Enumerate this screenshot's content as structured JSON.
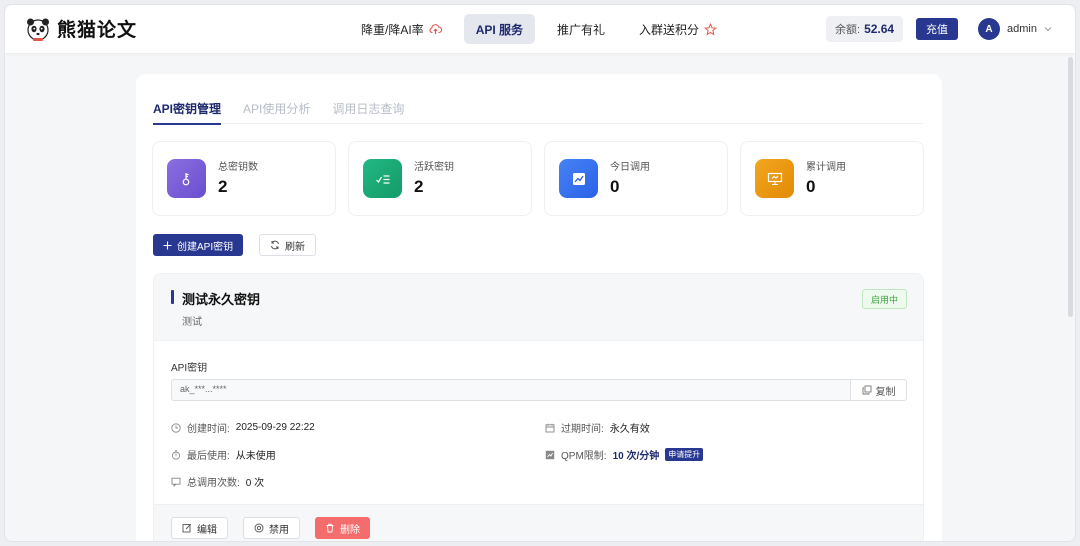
{
  "brand": {
    "name": "熊猫论文"
  },
  "nav": {
    "items": [
      {
        "label": "降重/降AI率",
        "icon": "cloud-upload-icon"
      },
      {
        "label": "API 服务",
        "active": true
      },
      {
        "label": "推广有礼"
      },
      {
        "label": "入群送积分",
        "icon": "star-icon"
      }
    ]
  },
  "header": {
    "balance_label": "余额:",
    "balance_value": "52.64",
    "recharge_label": "充值",
    "user_initial": "A",
    "username": "admin"
  },
  "tabs": [
    "API密钥管理",
    "API使用分析",
    "调用日志查询"
  ],
  "stats": [
    {
      "label": "总密钥数",
      "value": "2",
      "icon": "key-icon",
      "color": "#7a5cd6"
    },
    {
      "label": "活跃密钥",
      "value": "2",
      "icon": "check-list-icon",
      "color": "#19a874"
    },
    {
      "label": "今日调用",
      "value": "0",
      "icon": "trend-chart-icon",
      "color": "#2f6cf0"
    },
    {
      "label": "累计调用",
      "value": "0",
      "icon": "presentation-icon",
      "color": "#ee9a0e"
    }
  ],
  "actions": {
    "create_label": "创建API密钥",
    "refresh_label": "刷新"
  },
  "key_card": {
    "name": "测试永久密钥",
    "description": "测试",
    "status": "启用中",
    "key_label": "API密钥",
    "key_value": "ak_***...****",
    "copy_label": "复制",
    "created_label": "创建时间:",
    "created_value": "2025-09-29 22:22",
    "expire_label": "过期时间:",
    "expire_value": "永久有效",
    "last_used_label": "最后使用:",
    "last_used_value": "从未使用",
    "qpm_label": "QPM限制:",
    "qpm_value": "10 次/分钟",
    "qpm_upgrade": "申请提升",
    "total_calls_label": "总调用次数:",
    "total_calls_value": "0 次",
    "edit_label": "编辑",
    "disable_label": "禁用",
    "delete_label": "删除"
  }
}
